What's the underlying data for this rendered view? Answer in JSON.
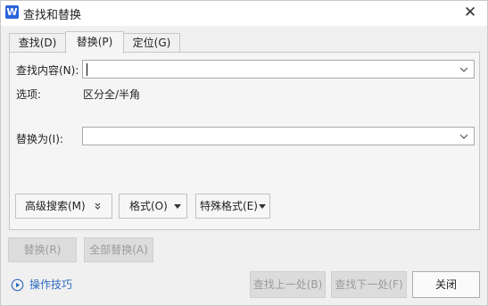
{
  "window": {
    "title": "查找和替换",
    "app_logo": "W",
    "close_glyph": "✕"
  },
  "tabs": [
    {
      "label": "查找(D)"
    },
    {
      "label": "替换(P)"
    },
    {
      "label": "定位(G)"
    }
  ],
  "find": {
    "label": "查找内容(N):",
    "value": ""
  },
  "options": {
    "label": "选项:",
    "value": "区分全/半角"
  },
  "replace": {
    "label": "替换为(I):",
    "value": ""
  },
  "panel_buttons": {
    "advanced": "高级搜索(M)",
    "format": "格式(O)",
    "special": "特殊格式(E)"
  },
  "action_buttons": {
    "replace": "替换(R)",
    "replace_all": "全部替换(A)",
    "find_prev": "查找上一处(B)",
    "find_next": "查找下一处(F)",
    "close": "关闭"
  },
  "help": {
    "label": "操作技巧"
  },
  "colors": {
    "accent": "#2c64d8",
    "link": "#2f6cc1",
    "disabled_text": "#9b9b9b"
  }
}
